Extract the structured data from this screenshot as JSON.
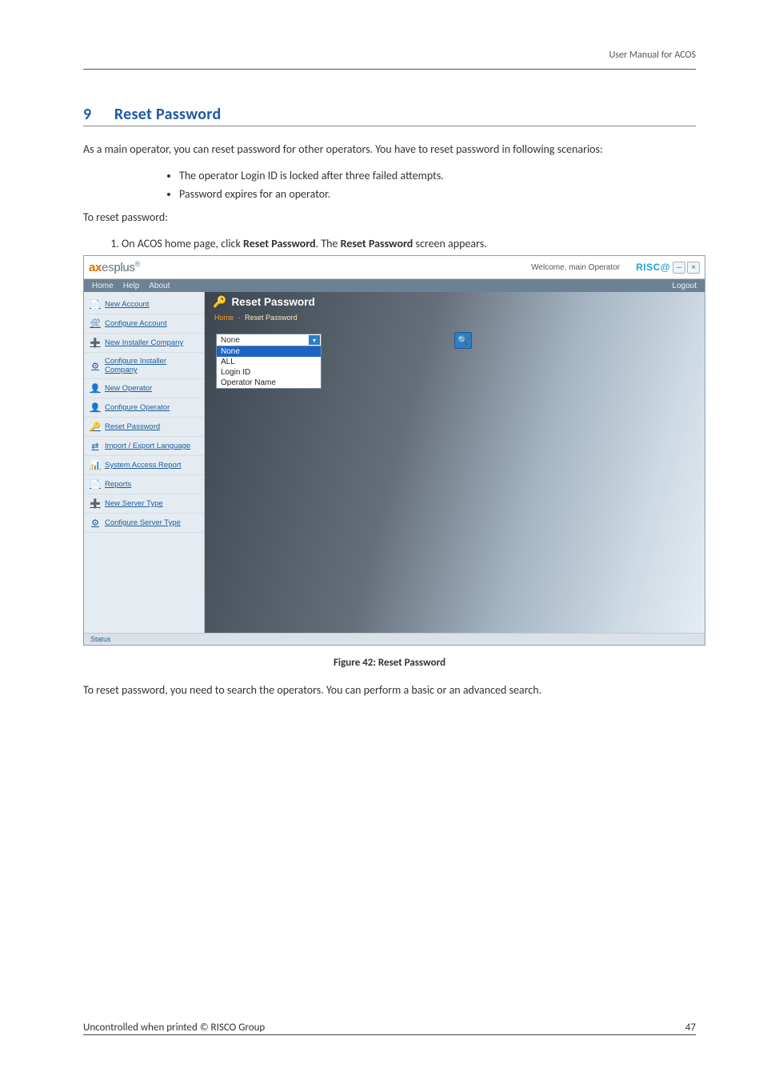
{
  "doc": {
    "header_right": "User Manual for ACOS",
    "section_number": "9",
    "section_title": "Reset Password",
    "intro": "As a main operator, you can reset password for other operators. You have to reset password in following scenarios:",
    "bullets": [
      "The operator Login ID is locked after three failed attempts.",
      "Password expires for an operator."
    ],
    "to_reset": "To reset password:",
    "step_prefix": "On ACOS home page, click ",
    "step_bold1": "Reset Password",
    "step_middle": ". The ",
    "step_bold2": "Reset Password",
    "step_suffix": " screen appears.",
    "figure_caption": "Figure 42: Reset Password",
    "after_figure": "To reset password, you need to search the operators. You can perform a basic or an advanced search.",
    "footer_left": "Uncontrolled when printed © RISCO Group",
    "footer_right": "47"
  },
  "app": {
    "brand_html": "axesplus",
    "welcome": "Welcome, main Operator",
    "risco": "RISC@",
    "menu": {
      "home": "Home",
      "help": "Help",
      "about": "About",
      "logout": "Logout"
    },
    "sidebar": [
      {
        "icon": "📄",
        "label": "New Account"
      },
      {
        "icon": "🛠",
        "label": "Configure Account"
      },
      {
        "icon": "➕",
        "label": "New Installer Company"
      },
      {
        "icon": "⚙",
        "label": "Configure Installer Company"
      },
      {
        "icon": "👤",
        "label": "New Operator"
      },
      {
        "icon": "👤",
        "label": "Configure Operator"
      },
      {
        "icon": "🔑",
        "label": "Reset Password"
      },
      {
        "icon": "⇄",
        "label": "Import / Export Language"
      },
      {
        "icon": "📊",
        "label": "System Access Report"
      },
      {
        "icon": "📄",
        "label": "Reports"
      },
      {
        "icon": "➕",
        "label": "New Server Type"
      },
      {
        "icon": "⚙",
        "label": "Configure Server Type"
      }
    ],
    "panel_title": "Reset Password",
    "crumbs": {
      "home": "Home",
      "here": "Reset Password"
    },
    "dropdown": {
      "selected": "None",
      "options": [
        "None",
        "ALL",
        "Login ID",
        "Operator Name"
      ]
    },
    "status": "Status"
  }
}
